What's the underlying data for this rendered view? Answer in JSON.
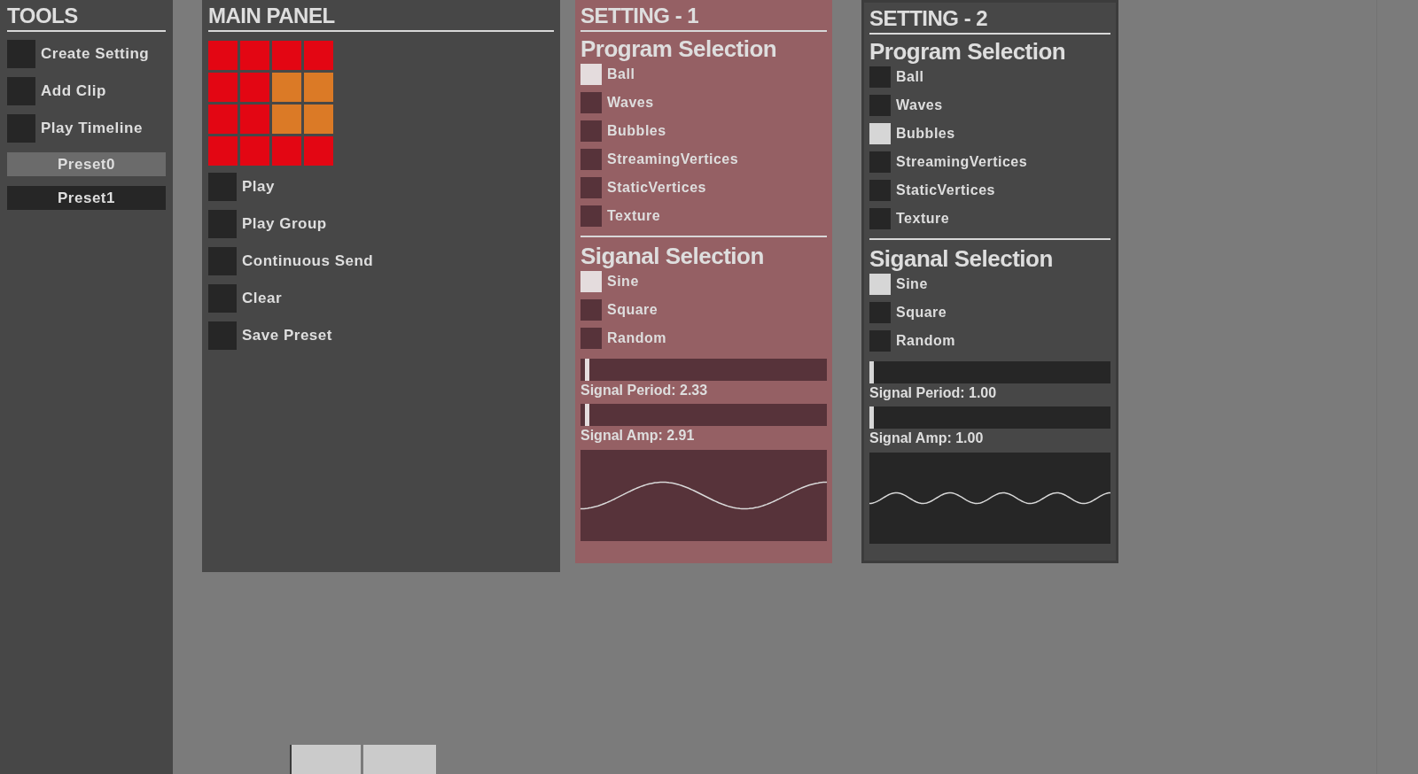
{
  "tools": {
    "title": "TOOLS",
    "actions": [
      {
        "label": "Create Setting",
        "checked": false
      },
      {
        "label": "Add Clip",
        "checked": false
      },
      {
        "label": "Play Timeline",
        "checked": false
      }
    ],
    "presets": [
      {
        "label": "Preset0",
        "selected": true
      },
      {
        "label": "Preset1",
        "selected": false
      }
    ]
  },
  "main_panel": {
    "title": "MAIN PANEL",
    "grid": [
      {
        "color": "#e30613"
      },
      {
        "color": "#e30613"
      },
      {
        "color": "#e30613"
      },
      {
        "color": "#e30613"
      },
      {
        "color": "#e30613"
      },
      {
        "color": "#e30613"
      },
      {
        "color": "#db7a26"
      },
      {
        "color": "#db7a26"
      },
      {
        "color": "#e30613"
      },
      {
        "color": "#e30613"
      },
      {
        "color": "#db7a26"
      },
      {
        "color": "#db7a26"
      },
      {
        "color": "#e30613"
      },
      {
        "color": "#e30613"
      },
      {
        "color": "#e30613"
      },
      {
        "color": "#e30613"
      }
    ],
    "actions": [
      {
        "label": "Play",
        "checked": false
      },
      {
        "label": "Play Group",
        "checked": false
      },
      {
        "label": "Continuous Send",
        "checked": false
      },
      {
        "label": "Clear",
        "checked": false
      },
      {
        "label": "Save Preset",
        "checked": false
      }
    ]
  },
  "settings": [
    {
      "title": "SETTING - 1",
      "selected": true,
      "program_heading": "Program Selection",
      "programs": [
        {
          "label": "Ball",
          "checked": true
        },
        {
          "label": "Waves",
          "checked": false
        },
        {
          "label": "Bubbles",
          "checked": false
        },
        {
          "label": "StreamingVertices",
          "checked": false
        },
        {
          "label": "StaticVertices",
          "checked": false
        },
        {
          "label": "Texture",
          "checked": false
        }
      ],
      "signal_heading": "Siganal Selection",
      "signals": [
        {
          "label": "Sine",
          "checked": true
        },
        {
          "label": "Square",
          "checked": false
        },
        {
          "label": "Random",
          "checked": false
        }
      ],
      "sliders": [
        {
          "label": "Signal Period: 2.33",
          "level": 0.02
        },
        {
          "label": "Signal Amp: 2.91",
          "level": 0.02
        }
      ]
    },
    {
      "title": "SETTING - 2",
      "selected": false,
      "program_heading": "Program Selection",
      "programs": [
        {
          "label": "Ball",
          "checked": false
        },
        {
          "label": "Waves",
          "checked": false
        },
        {
          "label": "Bubbles",
          "checked": true
        },
        {
          "label": "StreamingVertices",
          "checked": false
        },
        {
          "label": "StaticVertices",
          "checked": false
        },
        {
          "label": "Texture",
          "checked": false
        }
      ],
      "signal_heading": "Siganal Selection",
      "signals": [
        {
          "label": "Sine",
          "checked": true
        },
        {
          "label": "Square",
          "checked": false
        },
        {
          "label": "Random",
          "checked": false
        }
      ],
      "sliders": [
        {
          "label": "Signal Period: 1.00",
          "level": 0
        },
        {
          "label": "Signal Amp: 1.00",
          "level": 0
        }
      ]
    }
  ]
}
